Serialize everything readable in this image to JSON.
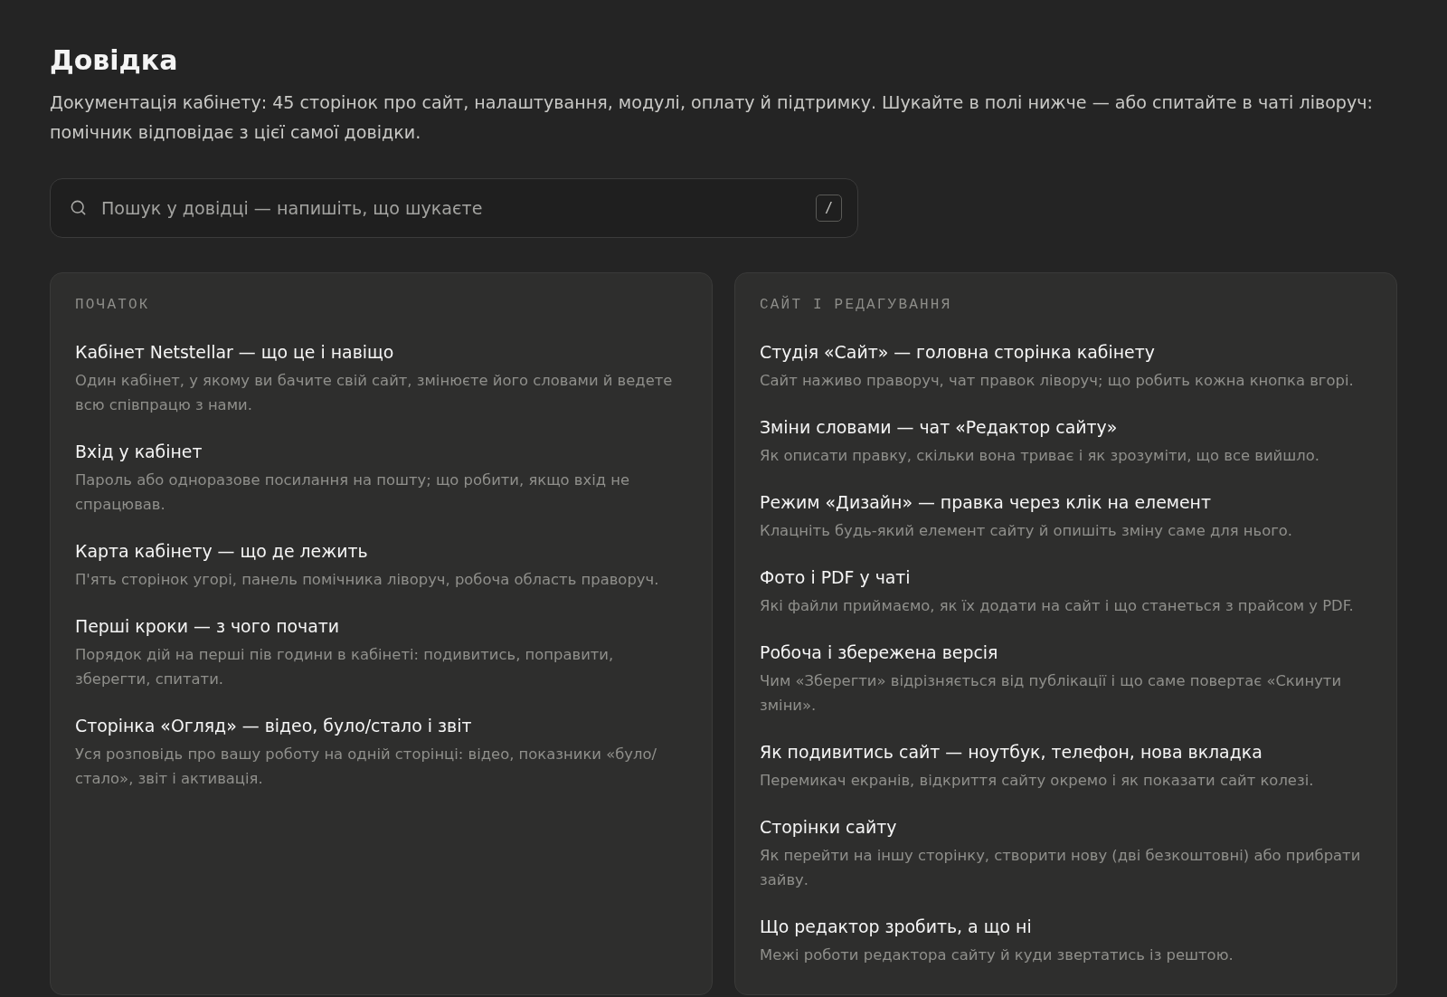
{
  "page": {
    "title": "Довідка",
    "description": "Документація кабінету: 45 сторінок про сайт, налаштування, модулі, оплату й підтримку. Шукайте в полі нижче — або спитайте в чаті ліворуч: помічник відповідає з цієї самої довідки."
  },
  "search": {
    "placeholder": "Пошук у довідці — напишіть, що шукаєте",
    "shortcut": "/"
  },
  "sections": [
    {
      "heading": "ПОЧАТОК",
      "articles": [
        {
          "title": "Кабінет Netstellar — що це і навіщо",
          "summary": "Один кабінет, у якому ви бачите свій сайт, змінюєте його словами й ведете всю співпрацю з нами."
        },
        {
          "title": "Вхід у кабінет",
          "summary": "Пароль або одноразове посилання на пошту; що робити, якщо вхід не спрацював."
        },
        {
          "title": "Карта кабінету — що де лежить",
          "summary": "П'ять сторінок угорі, панель помічника ліворуч, робоча область праворуч."
        },
        {
          "title": "Перші кроки — з чого почати",
          "summary": "Порядок дій на перші пів години в кабінеті: подивитись, поправити, зберегти, спитати."
        },
        {
          "title": "Сторінка «Огляд» — відео, було/стало і звіт",
          "summary": "Уся розповідь про вашу роботу на одній сторінці: відео, показники «було/стало», звіт і активація."
        }
      ]
    },
    {
      "heading": "САЙТ І РЕДАГУВАННЯ",
      "articles": [
        {
          "title": "Студія «Сайт» — головна сторінка кабінету",
          "summary": "Сайт наживо праворуч, чат правок ліворуч; що робить кожна кнопка вгорі."
        },
        {
          "title": "Зміни словами — чат «Редактор сайту»",
          "summary": "Як описати правку, скільки вона триває і як зрозуміти, що все вийшло."
        },
        {
          "title": "Режим «Дизайн» — правка через клік на елемент",
          "summary": "Клацніть будь-який елемент сайту й опишіть зміну саме для нього."
        },
        {
          "title": "Фото і PDF у чаті",
          "summary": "Які файли приймаємо, як їх додати на сайт і що станеться з прайсом у PDF."
        },
        {
          "title": "Робоча і збережена версія",
          "summary": "Чим «Зберегти» відрізняється від публікації і що саме повертає «Скинути зміни»."
        },
        {
          "title": "Як подивитись сайт — ноутбук, телефон, нова вкладка",
          "summary": "Перемикач екранів, відкриття сайту окремо і як показати сайт колезі."
        },
        {
          "title": "Сторінки сайту",
          "summary": "Як перейти на іншу сторінку, створити нову (дві безкоштовні) або прибрати зайву."
        },
        {
          "title": "Що редактор зробить, а що ні",
          "summary": "Межі роботи редактора сайту й куди звертатись із рештою."
        }
      ]
    }
  ]
}
